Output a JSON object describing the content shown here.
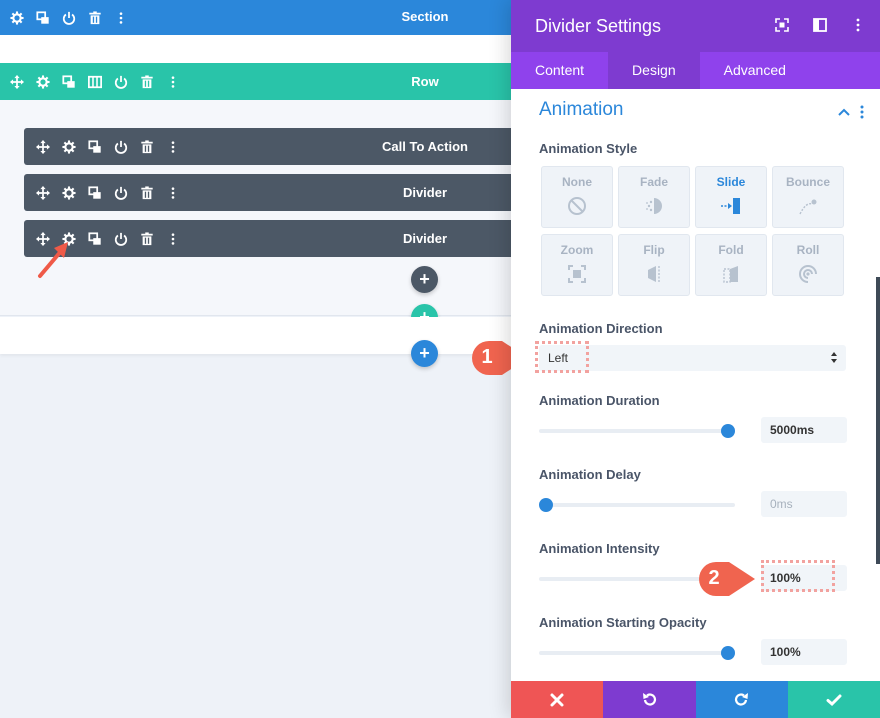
{
  "builder": {
    "section_label": "Section",
    "row_label": "Row",
    "modules": [
      {
        "label": "Call To Action"
      },
      {
        "label": "Divider"
      },
      {
        "label": "Divider"
      }
    ]
  },
  "modal": {
    "title": "Divider Settings",
    "tabs": [
      {
        "label": "Content"
      },
      {
        "label": "Design"
      },
      {
        "label": "Advanced"
      }
    ],
    "group_title": "Animation",
    "animation_style": {
      "label": "Animation Style",
      "options": [
        {
          "label": "None"
        },
        {
          "label": "Fade"
        },
        {
          "label": "Slide"
        },
        {
          "label": "Bounce"
        },
        {
          "label": "Zoom"
        },
        {
          "label": "Flip"
        },
        {
          "label": "Fold"
        },
        {
          "label": "Roll"
        }
      ],
      "selected": "Slide"
    },
    "animation_direction": {
      "label": "Animation Direction",
      "value": "Left"
    },
    "animation_duration": {
      "label": "Animation Duration",
      "value": "5000ms",
      "slider_fraction": 0.97
    },
    "animation_delay": {
      "label": "Animation Delay",
      "placeholder": "0ms",
      "slider_fraction": 0.0
    },
    "animation_intensity": {
      "label": "Animation Intensity",
      "value": "100%"
    },
    "animation_starting_opacity": {
      "label": "Animation Starting Opacity",
      "value": "100%",
      "slider_fraction": 0.97
    }
  },
  "callouts": [
    {
      "number": "1"
    },
    {
      "number": "2"
    }
  ],
  "colors": {
    "section": "#2b87da",
    "row": "#29c4a9",
    "module": "#4c5866",
    "modal_header": "#7e3bd0",
    "modal_tabs": "#8f42ec",
    "accent_blue": "#2b87da",
    "cancel": "#ef5555",
    "undo": "#7e3bd0",
    "redo": "#2b87da",
    "save": "#29c4a9",
    "callout": "#f0644f"
  }
}
